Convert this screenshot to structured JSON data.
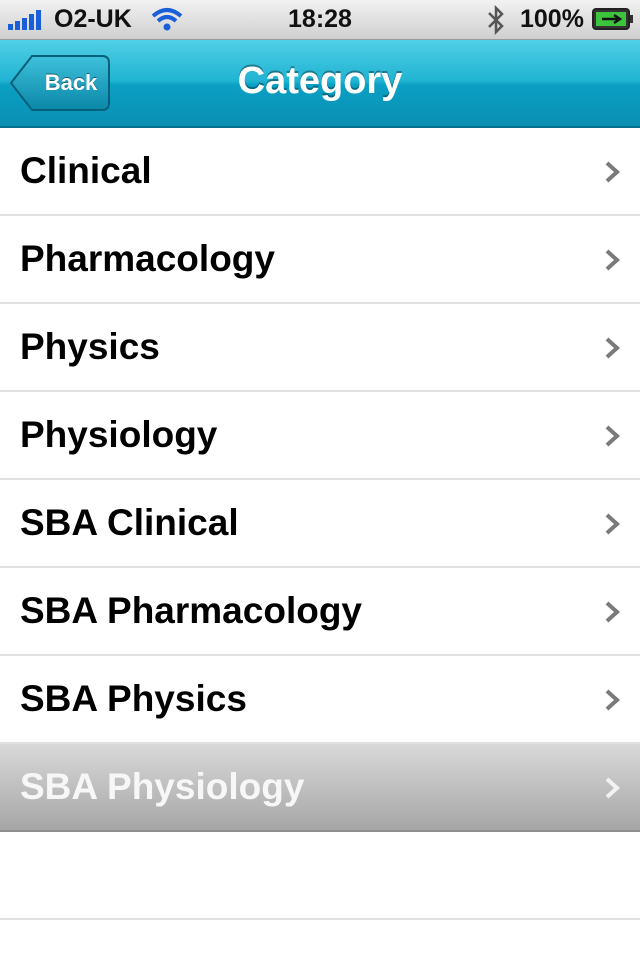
{
  "status_bar": {
    "carrier": "O2-UK",
    "time": "18:28",
    "battery": "100%",
    "signal_icon": "signal-bars-icon",
    "wifi_icon": "wifi-icon",
    "bluetooth_icon": "bluetooth-icon",
    "battery_icon": "battery-charging-icon"
  },
  "nav_bar": {
    "back_label": "Back",
    "title": "Category"
  },
  "categories": [
    {
      "label": "Clinical",
      "selected": false
    },
    {
      "label": "Pharmacology",
      "selected": false
    },
    {
      "label": "Physics",
      "selected": false
    },
    {
      "label": "Physiology",
      "selected": false
    },
    {
      "label": "SBA Clinical",
      "selected": false
    },
    {
      "label": "SBA Pharmacology",
      "selected": false
    },
    {
      "label": "SBA Physics",
      "selected": false
    },
    {
      "label": "SBA Physiology",
      "selected": true
    }
  ],
  "colors": {
    "nav_accent": "#20b3d2",
    "selected_row": "#b8b8b8",
    "chevron": "#7a7a7a"
  }
}
